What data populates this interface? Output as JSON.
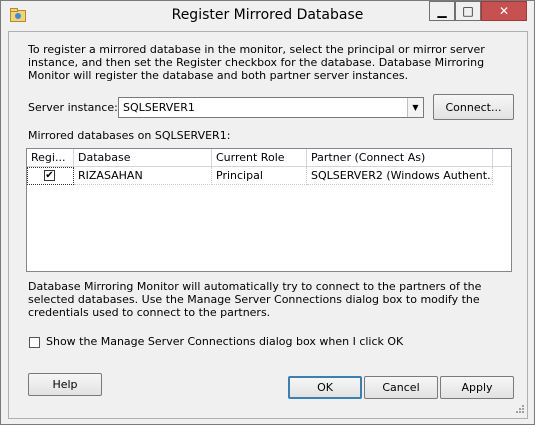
{
  "window": {
    "title": "Register Mirrored Database",
    "controls": {
      "minimize": "▁",
      "maximize": "□",
      "close": "✕"
    }
  },
  "intro_text": "To register a mirrored database in the monitor, select the principal or mirror server instance, and then set the Register checkbox for the database. Database Mirroring Monitor will register the database and both partner server instances.",
  "server_instance": {
    "label": "Server instance:",
    "value": "SQLSERVER1",
    "connect_label": "Connect..."
  },
  "databases": {
    "label": "Mirrored databases on SQLSERVER1:",
    "columns": [
      "Regi...",
      "Database",
      "Current Role",
      "Partner (Connect As)"
    ],
    "rows": [
      {
        "register": true,
        "database": "RIZASAHAN",
        "role": "Principal",
        "partner": "SQLSERVER2 (Windows Authent..."
      }
    ]
  },
  "note_text": "Database Mirroring Monitor will automatically try to connect to the partners of the selected databases. Use the Manage Server Connections dialog box to modify the credentials used to connect to the partners.",
  "show_manage_checkbox": {
    "label": "Show the Manage Server Connections dialog box when I click OK",
    "checked": false
  },
  "buttons": {
    "help": "Help",
    "ok": "OK",
    "cancel": "Cancel",
    "apply": "Apply"
  }
}
